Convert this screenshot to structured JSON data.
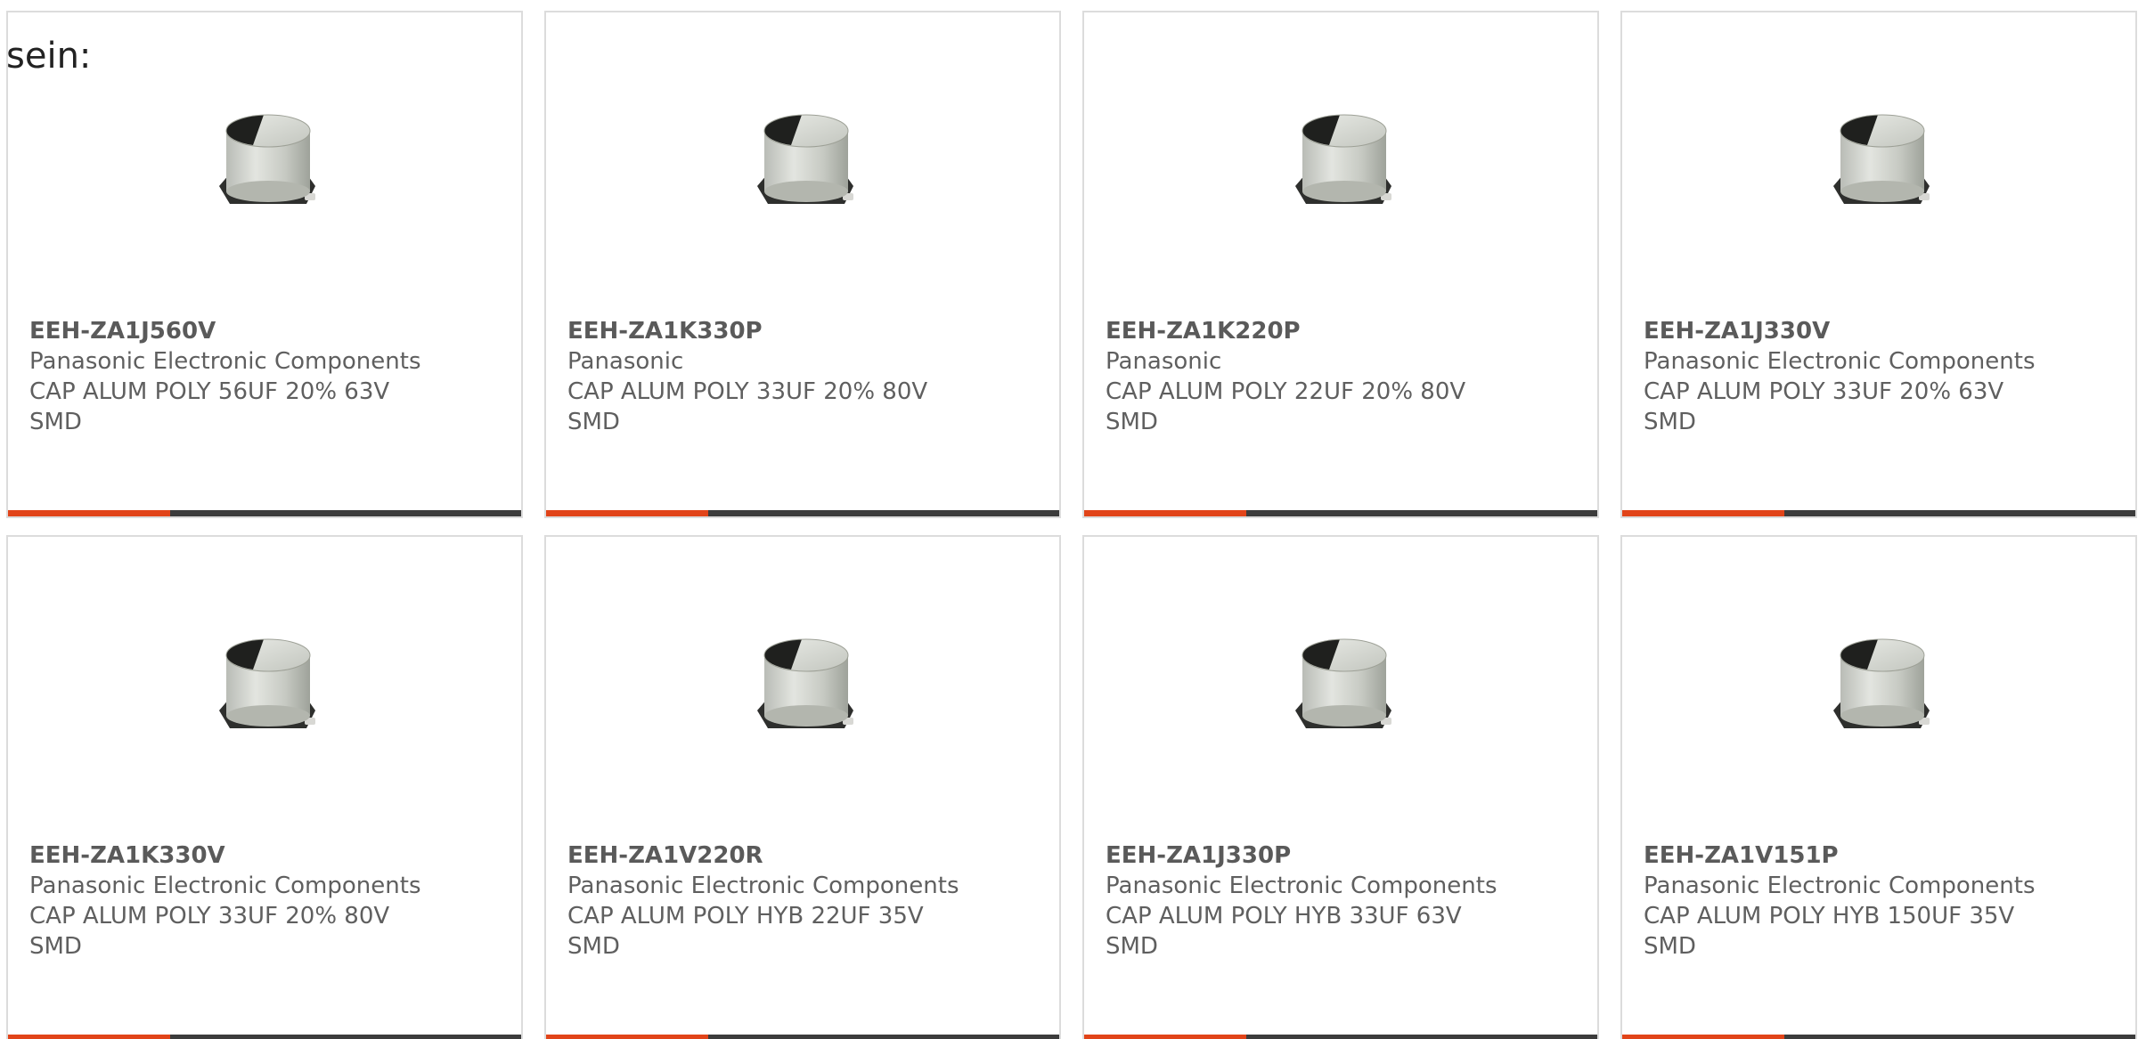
{
  "intro_text": "sein:",
  "colors": {
    "accent": "#e14419",
    "bar": "#3c3c3c",
    "border": "#dcdcdc",
    "text": "#5f5f5f"
  },
  "products": [
    {
      "part_number": "EEH-ZA1J560V",
      "manufacturer": "Panasonic Electronic Components",
      "desc_line1": "CAP ALUM POLY 56UF 20% 63V",
      "desc_line2": "SMD",
      "image_icon": "capacitor-image"
    },
    {
      "part_number": "EEH-ZA1K330P",
      "manufacturer": "Panasonic",
      "desc_line1": "CAP ALUM POLY 33UF 20% 80V",
      "desc_line2": "SMD",
      "image_icon": "capacitor-image"
    },
    {
      "part_number": "EEH-ZA1K220P",
      "manufacturer": "Panasonic",
      "desc_line1": "CAP ALUM POLY 22UF 20% 80V",
      "desc_line2": "SMD",
      "image_icon": "capacitor-image"
    },
    {
      "part_number": "EEH-ZA1J330V",
      "manufacturer": "Panasonic Electronic Components",
      "desc_line1": "CAP ALUM POLY 33UF 20% 63V",
      "desc_line2": "SMD",
      "image_icon": "capacitor-image"
    },
    {
      "part_number": "EEH-ZA1K330V",
      "manufacturer": "Panasonic Electronic Components",
      "desc_line1": "CAP ALUM POLY 33UF 20% 80V",
      "desc_line2": "SMD",
      "image_icon": "capacitor-image"
    },
    {
      "part_number": "EEH-ZA1V220R",
      "manufacturer": "Panasonic Electronic Components",
      "desc_line1": "CAP ALUM POLY HYB 22UF 35V",
      "desc_line2": "SMD",
      "image_icon": "capacitor-image"
    },
    {
      "part_number": "EEH-ZA1J330P",
      "manufacturer": "Panasonic Electronic Components",
      "desc_line1": "CAP ALUM POLY HYB 33UF 63V",
      "desc_line2": "SMD",
      "image_icon": "capacitor-image"
    },
    {
      "part_number": "EEH-ZA1V151P",
      "manufacturer": "Panasonic Electronic Components",
      "desc_line1": "CAP ALUM POLY HYB 150UF 35V",
      "desc_line2": "SMD",
      "image_icon": "capacitor-image"
    }
  ]
}
